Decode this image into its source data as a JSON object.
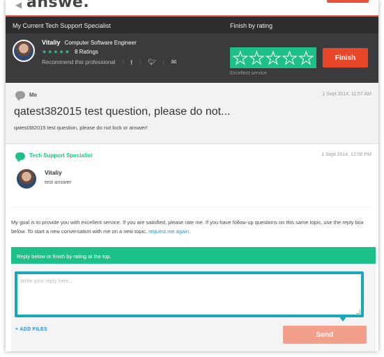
{
  "brand": {
    "logo_text": "answe.",
    "back_glyph": "◀"
  },
  "header": {
    "specialist_section_title": "My Current Tech Support Specialist",
    "finish_section_title": "Finish by rating",
    "specialist": {
      "name": "Vitaliy",
      "role": "Computer Software Engineer",
      "stars": "★★★★★",
      "ratings_text": "8 Ratings",
      "recommend_text": "Recommend this professional",
      "social_icons": [
        "facebook-icon",
        "twitter-icon",
        "email-icon"
      ]
    },
    "rating_caption": "Excellent service",
    "rating_stars_filled": 0,
    "rating_stars_total": 5,
    "finish_label": "Finish"
  },
  "question": {
    "author": "Me",
    "date": "1 Sept 2014, 11:57 AM",
    "title": "qatest382015 test question, please do not...",
    "body": "qatest382015 test question, please do not lock or answer!"
  },
  "answer": {
    "label": "Tech Support Specialist",
    "date": "1 Sept 2014, 12:00 PM",
    "name": "Vitaliy",
    "text": "test answer",
    "message": "My goal is to provide you with excellent service. If you are satisfied, please rate me. If you have follow-up questions on this same topic, use the reply box below. To start a new conversation with me on a new topic,",
    "link_text": "request me again",
    "message_end": "."
  },
  "reply": {
    "bar_text": "Reply below or finish by rating at the top.",
    "placeholder": "Write your reply here...",
    "add_files_label": "+ ADD FILES",
    "send_label": "Send"
  },
  "colors": {
    "accent_green": "#1ec08a",
    "accent_orange": "#e8472a",
    "reply_border": "#1aa8b8",
    "link_blue": "#2a8fd0",
    "header_dark": "#3b3b3e"
  }
}
